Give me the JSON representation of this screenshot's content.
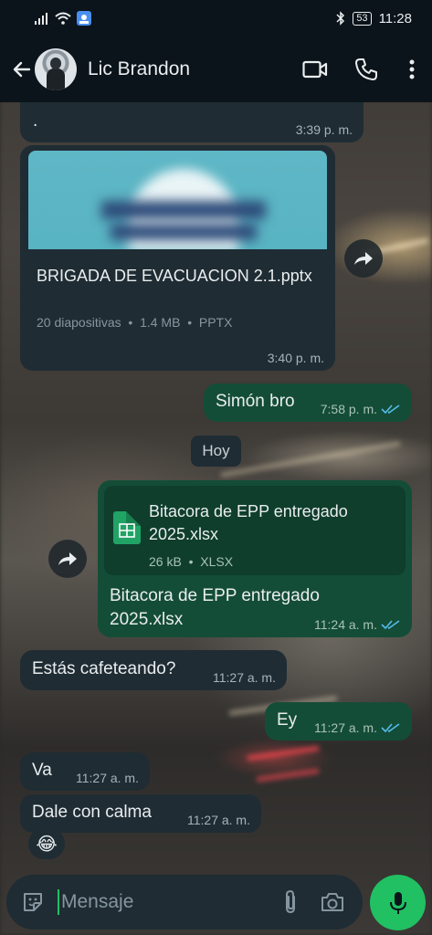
{
  "status_bar": {
    "battery": "53",
    "time": "11:28"
  },
  "header": {
    "contact_name": "Lic Brandon"
  },
  "messages": {
    "m1": {
      "text": ".",
      "time": "3:39 p. m."
    },
    "m2": {
      "file_name": "BRIGADA DE EVACUACION 2.1.pptx",
      "meta": "20 diapositivas  •  1.4 MB  •  PPTX",
      "time": "3:40 p. m."
    },
    "m3": {
      "text": "Simón bro",
      "time": "7:58 p. m."
    },
    "day_chip": "Hoy",
    "m4": {
      "file_name": "Bitacora de EPP entregado 2025.xlsx",
      "meta": "26 kB  •  XLSX",
      "caption": "Bitacora de EPP entregado 2025.xlsx",
      "time": "11:24 a. m."
    },
    "m5": {
      "text": "Estás cafeteando?",
      "time": "11:27 a. m."
    },
    "m6": {
      "text": "Ey",
      "time": "11:27 a. m."
    },
    "m7": {
      "text": "Va",
      "time": "11:27 a. m."
    },
    "m8": {
      "text": "Dale con calma",
      "time": "11:27 a. m.",
      "reaction": "😂"
    }
  },
  "composer": {
    "placeholder": "Mensaje"
  },
  "colors": {
    "accent": "#21c063",
    "outgoing": "#144d37",
    "incoming": "#1f2c33",
    "read_ticks": "#53bdeb"
  }
}
